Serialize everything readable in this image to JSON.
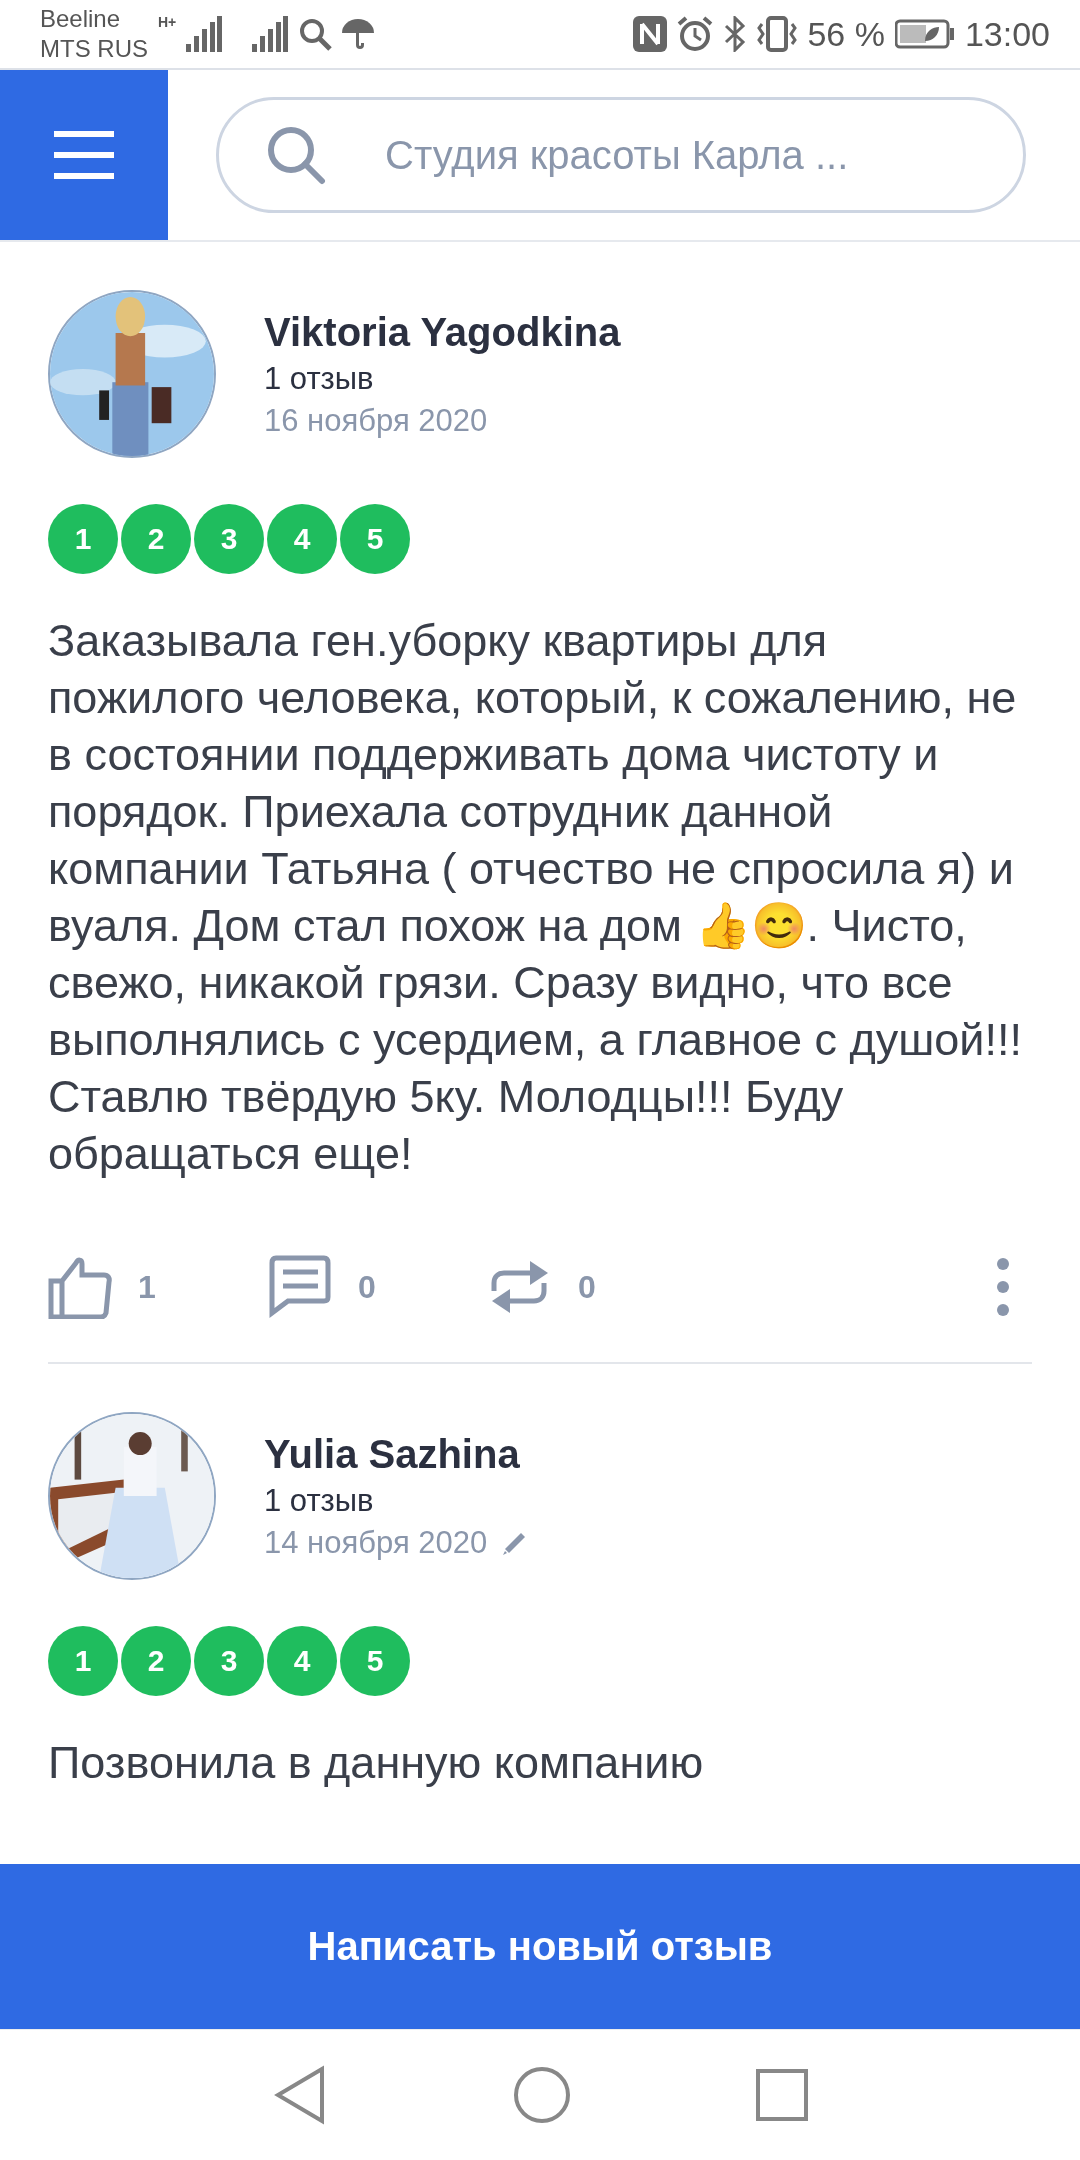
{
  "status_bar": {
    "carrier_1": "Beeline",
    "carrier_2": "MTS RUS",
    "network": "H+",
    "battery": "56 %",
    "time": "13:00"
  },
  "header": {
    "search": {
      "placeholder": "Студия красоты Карла ..."
    }
  },
  "reviews": [
    {
      "author": "Viktoria Yagodkina",
      "count": "1 отзыв",
      "date": "16 ноября 2020",
      "edited": false,
      "ratings": [
        {
          "label": "1",
          "filled": true
        },
        {
          "label": "2",
          "filled": true
        },
        {
          "label": "3",
          "filled": true
        },
        {
          "label": "4",
          "filled": true
        },
        {
          "label": "5",
          "filled": true
        }
      ],
      "text": "Заказывала ген.уборку квартиры для пожилого человека, который, к сожалению, не в состоянии поддерживать дома чистоту и порядок. Приехала сотрудник данной компании Татьяна ( отчество не спросила я) и вуаля. Дом стал похож на дом 👍😊. Чисто, свежо, никакой грязи. Сразу видно, что все выполнялись с усердием, а главное с душой!!! Ставлю твёрдую 5ку. Молодцы!!! Буду обращаться еще!",
      "likes": "1",
      "comments": "0",
      "reposts": "0"
    },
    {
      "author": "Yulia Sazhina",
      "count": "1 отзыв",
      "date": "14 ноября 2020",
      "edited": true,
      "ratings": [
        {
          "label": "1",
          "filled": true
        },
        {
          "label": "2",
          "filled": true
        },
        {
          "label": "3",
          "filled": true
        },
        {
          "label": "4",
          "filled": true
        },
        {
          "label": "5",
          "filled": true
        }
      ],
      "text": "Позвонила в данную компанию"
    }
  ],
  "write_button": "Написать новый отзыв"
}
